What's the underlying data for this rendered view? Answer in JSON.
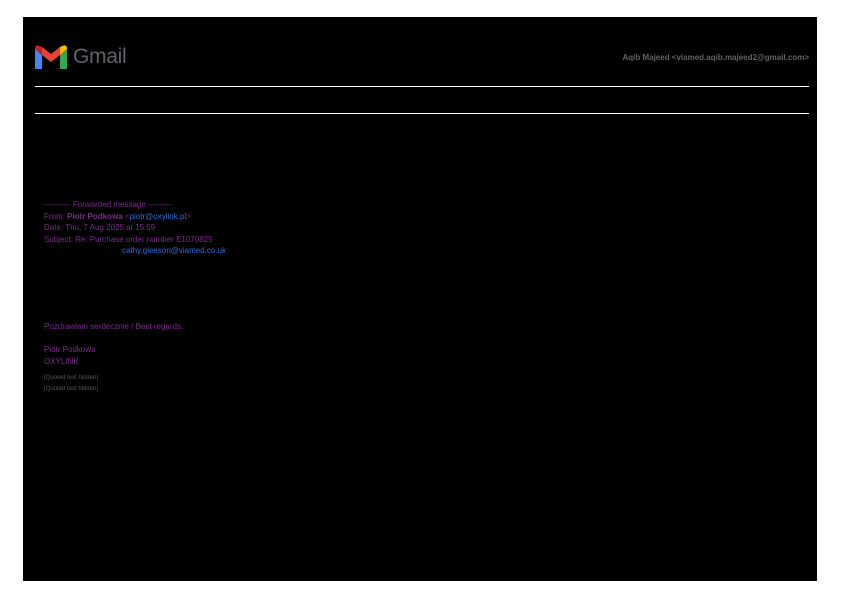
{
  "header": {
    "logo_text": "Gmail",
    "logo_icon": "gmail-m-icon",
    "account": "Aqib Majeed <viamed.aqib.majeed2@gmail.com>"
  },
  "forward": {
    "separator": "---------- Forwarded message ---------",
    "from_label": "From: ",
    "from_name": "Piotr Podkowa",
    "from_email_open": " <",
    "from_email": "piotr@oxylink.pl",
    "from_email_close": ">",
    "date": "Date: Thu, 7 Aug 2025 at 15:59",
    "subject": "Subject: Re: Purchase order number E1070825",
    "cc_email": "cathy.gleeson@viamed.co.uk"
  },
  "signature": {
    "greeting": "Pozdrawiam serdecznie / Best regards,",
    "name": "Piotr Podkowa",
    "company": "OXYLINK"
  },
  "quoted": [
    "[Quoted text hidden]",
    "[Quoted text hidden]"
  ],
  "colors": {
    "text": "#7b2c8c",
    "link": "#2f6bd6",
    "logo_text": "#5f6368",
    "background": "#000000"
  }
}
